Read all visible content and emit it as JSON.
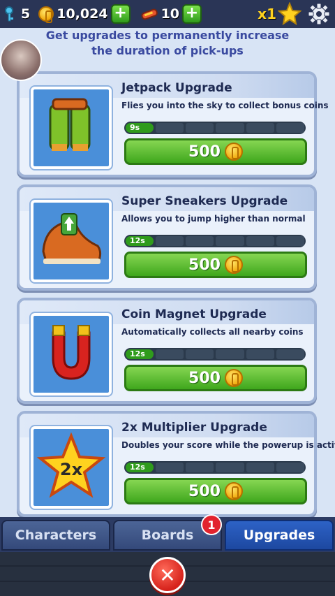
{
  "topbar": {
    "keys": "5",
    "coins": "10,024",
    "boards": "10",
    "multiplier": "x1"
  },
  "header": {
    "text": "Get upgrades to permanently increase the duration of pick-ups"
  },
  "upgrades": [
    {
      "title": "Jetpack Upgrade",
      "desc": "Flies you into the sky to collect bonus coins",
      "level_label": "9s",
      "level_filled": 1,
      "level_total": 6,
      "price": "500",
      "icon": "jetpack-icon"
    },
    {
      "title": "Super Sneakers Upgrade",
      "desc": "Allows you to jump higher than normal",
      "level_label": "12s",
      "level_filled": 1,
      "level_total": 6,
      "price": "500",
      "icon": "sneaker-icon"
    },
    {
      "title": "Coin Magnet Upgrade",
      "desc": "Automatically collects all nearby coins",
      "level_label": "12s",
      "level_filled": 1,
      "level_total": 6,
      "price": "500",
      "icon": "magnet-icon"
    },
    {
      "title": "2x Multiplier Upgrade",
      "desc": "Doubles your score while the powerup is active",
      "level_label": "12s",
      "level_filled": 1,
      "level_total": 6,
      "price": "500",
      "icon": "star-2x-icon",
      "icon_text": "2x"
    }
  ],
  "tabs": [
    {
      "label": "Characters",
      "active": false
    },
    {
      "label": "Boards",
      "active": false,
      "badge": "1"
    },
    {
      "label": "Upgrades",
      "active": true
    }
  ],
  "colors": {
    "accent_green": "#3fa71d",
    "tab_active": "#1d48a0",
    "badge_red": "#e2232e"
  }
}
